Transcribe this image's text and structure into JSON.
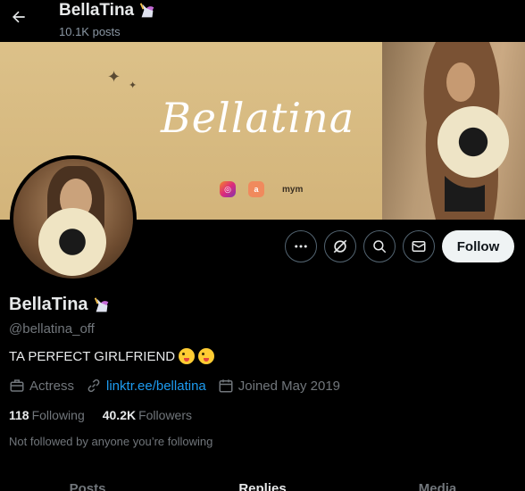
{
  "header": {
    "name": "BellaTina",
    "posts": "10.1K posts"
  },
  "banner": {
    "brand_text": "Bellatina",
    "icons": [
      "instagram-icon",
      "a-icon",
      "mym-icon"
    ],
    "mym_label": "mym"
  },
  "profile": {
    "name": "BellaTina",
    "handle": "@bellatina_off",
    "bio": "TA PERFECT GIRLFRIEND",
    "category": "Actress",
    "link": "linktr.ee/bellatina",
    "joined": "Joined May 2019",
    "following_count": "118",
    "following_label": "Following",
    "followers_count": "40.2K",
    "followers_label": "Followers",
    "not_followed": "Not followed by anyone you’re following"
  },
  "actions": {
    "follow_label": "Follow",
    "icons": [
      "more-icon",
      "grok-icon",
      "search-icon",
      "message-icon"
    ]
  },
  "tabs": [
    "Posts",
    "Replies",
    "Media"
  ],
  "colors": {
    "background": "#000000",
    "link": "#1d9bf0",
    "secondary_text": "#71767b",
    "follow_bg": "#eff3f4"
  }
}
